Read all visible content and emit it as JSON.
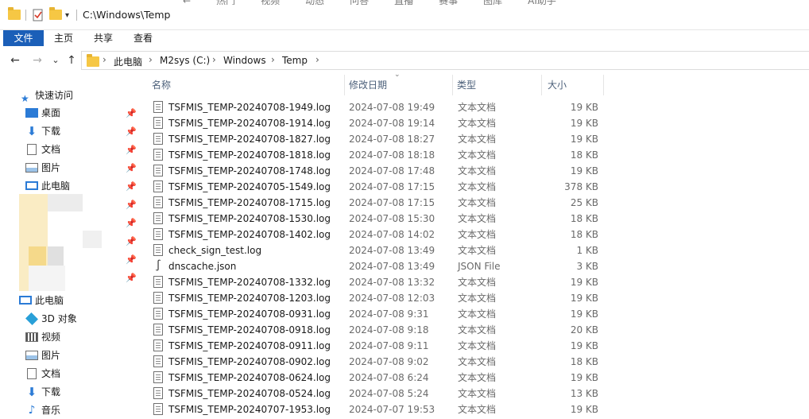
{
  "titlebar": {
    "title": "C:\\Windows\\Temp",
    "browser_strip": [
      "←",
      "热门",
      "视频",
      "动态",
      "问答",
      "直播",
      "赛事",
      "图库",
      "AI助手"
    ]
  },
  "ribbon": {
    "tabs": [
      {
        "label": "文件",
        "active": true
      },
      {
        "label": "主页",
        "active": false
      },
      {
        "label": "共享",
        "active": false
      },
      {
        "label": "查看",
        "active": false
      }
    ]
  },
  "nav": {
    "back": "←",
    "forward": "→",
    "recent": "⌄",
    "up": "↑",
    "breadcrumb": [
      "此电脑",
      "M2sys (C:)",
      "Windows",
      "Temp"
    ]
  },
  "sidebar": {
    "quick_access": "快速访问",
    "pinned": [
      {
        "label": "桌面",
        "icon": "desktop-icon"
      },
      {
        "label": "下载",
        "icon": "download-icon"
      },
      {
        "label": "文档",
        "icon": "document-icon"
      },
      {
        "label": "图片",
        "icon": "picture-icon"
      },
      {
        "label": "此电脑",
        "icon": "computer-icon"
      }
    ],
    "this_pc": "此电脑",
    "pc_items": [
      {
        "label": "3D 对象",
        "icon": "3d-objects-icon"
      },
      {
        "label": "视频",
        "icon": "video-icon"
      },
      {
        "label": "图片",
        "icon": "picture-icon"
      },
      {
        "label": "文档",
        "icon": "document-icon"
      },
      {
        "label": "下载",
        "icon": "download-icon"
      },
      {
        "label": "音乐",
        "icon": "music-icon"
      }
    ]
  },
  "columns": {
    "name": "名称",
    "date": "修改日期",
    "type": "类型",
    "size": "大小"
  },
  "files": [
    {
      "name": "TSFMIS_TEMP-20240708-1949.log",
      "date": "2024-07-08 19:49",
      "type": "文本文档",
      "size": "19 KB",
      "icon": "text-file-icon"
    },
    {
      "name": "TSFMIS_TEMP-20240708-1914.log",
      "date": "2024-07-08 19:14",
      "type": "文本文档",
      "size": "19 KB",
      "icon": "text-file-icon"
    },
    {
      "name": "TSFMIS_TEMP-20240708-1827.log",
      "date": "2024-07-08 18:27",
      "type": "文本文档",
      "size": "19 KB",
      "icon": "text-file-icon"
    },
    {
      "name": "TSFMIS_TEMP-20240708-1818.log",
      "date": "2024-07-08 18:18",
      "type": "文本文档",
      "size": "18 KB",
      "icon": "text-file-icon"
    },
    {
      "name": "TSFMIS_TEMP-20240708-1748.log",
      "date": "2024-07-08 17:48",
      "type": "文本文档",
      "size": "19 KB",
      "icon": "text-file-icon"
    },
    {
      "name": "TSFMIS_TEMP-20240705-1549.log",
      "date": "2024-07-08 17:15",
      "type": "文本文档",
      "size": "378 KB",
      "icon": "text-file-icon"
    },
    {
      "name": "TSFMIS_TEMP-20240708-1715.log",
      "date": "2024-07-08 17:15",
      "type": "文本文档",
      "size": "25 KB",
      "icon": "text-file-icon"
    },
    {
      "name": "TSFMIS_TEMP-20240708-1530.log",
      "date": "2024-07-08 15:30",
      "type": "文本文档",
      "size": "18 KB",
      "icon": "text-file-icon"
    },
    {
      "name": "TSFMIS_TEMP-20240708-1402.log",
      "date": "2024-07-08 14:02",
      "type": "文本文档",
      "size": "18 KB",
      "icon": "text-file-icon"
    },
    {
      "name": "check_sign_test.log",
      "date": "2024-07-08 13:49",
      "type": "文本文档",
      "size": "1 KB",
      "icon": "text-file-icon"
    },
    {
      "name": "dnscache.json",
      "date": "2024-07-08 13:49",
      "type": "JSON File",
      "size": "3 KB",
      "icon": "json-file-icon"
    },
    {
      "name": "TSFMIS_TEMP-20240708-1332.log",
      "date": "2024-07-08 13:32",
      "type": "文本文档",
      "size": "19 KB",
      "icon": "text-file-icon"
    },
    {
      "name": "TSFMIS_TEMP-20240708-1203.log",
      "date": "2024-07-08 12:03",
      "type": "文本文档",
      "size": "19 KB",
      "icon": "text-file-icon"
    },
    {
      "name": "TSFMIS_TEMP-20240708-0931.log",
      "date": "2024-07-08 9:31",
      "type": "文本文档",
      "size": "19 KB",
      "icon": "text-file-icon"
    },
    {
      "name": "TSFMIS_TEMP-20240708-0918.log",
      "date": "2024-07-08 9:18",
      "type": "文本文档",
      "size": "20 KB",
      "icon": "text-file-icon"
    },
    {
      "name": "TSFMIS_TEMP-20240708-0911.log",
      "date": "2024-07-08 9:11",
      "type": "文本文档",
      "size": "19 KB",
      "icon": "text-file-icon"
    },
    {
      "name": "TSFMIS_TEMP-20240708-0902.log",
      "date": "2024-07-08 9:02",
      "type": "文本文档",
      "size": "18 KB",
      "icon": "text-file-icon"
    },
    {
      "name": "TSFMIS_TEMP-20240708-0624.log",
      "date": "2024-07-08 6:24",
      "type": "文本文档",
      "size": "19 KB",
      "icon": "text-file-icon"
    },
    {
      "name": "TSFMIS_TEMP-20240708-0524.log",
      "date": "2024-07-08 5:24",
      "type": "文本文档",
      "size": "13 KB",
      "icon": "text-file-icon"
    },
    {
      "name": "TSFMIS_TEMP-20240707-1953.log",
      "date": "2024-07-07 19:53",
      "type": "文本文档",
      "size": "19 KB",
      "icon": "text-file-icon"
    }
  ],
  "colors": {
    "accent": "#1b5fb8",
    "folder": "#f6c744",
    "header_text": "#4c607a",
    "secondary_text": "#6a6a6a"
  }
}
